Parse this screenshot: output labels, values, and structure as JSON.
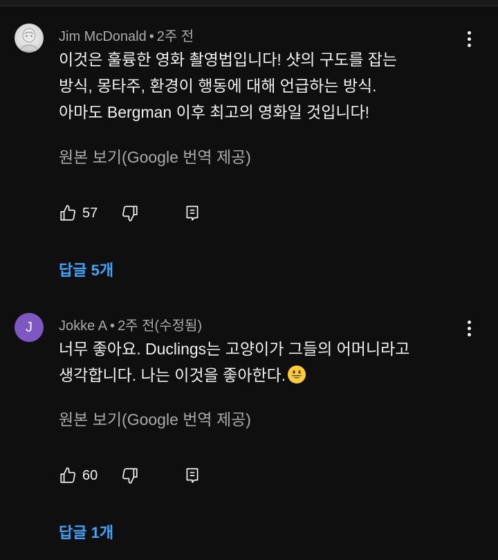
{
  "comments": [
    {
      "author": "Jim McDonald",
      "time": "2주 전",
      "avatar_type": "photo",
      "avatar_letter": "",
      "lines": [
        "이것은 훌륭한 영화 촬영법입니다! 샷의 구도를 잡는",
        "방식, 몽타주, 환경이 행동에 대해 언급하는 방식.",
        "아마도 Bergman 이후 최고의 영화일 것입니다!"
      ],
      "translate_label": "원본 보기(Google 번역 제공)",
      "likes": "57",
      "replies_label": "답글 5개"
    },
    {
      "author": "Jokke A",
      "time": "2주 전(수정됨)",
      "avatar_type": "letter",
      "avatar_letter": "J",
      "avatar_color": "#7e57c2",
      "lines": [
        "너무 좋아요. Duclings는 고양이가 그들의 어머니라고",
        "생각합니다. 나는 이것을 좋아한다."
      ],
      "emoji": "grinning-face",
      "translate_label": "원본 보기(Google 번역 제공)",
      "likes": "60",
      "replies_label": "답글 1개"
    }
  ],
  "colors": {
    "background": "#0f0f0f",
    "text": "#f1f1f1",
    "secondary_text": "#aaaaaa",
    "link": "#3ea6ff"
  }
}
